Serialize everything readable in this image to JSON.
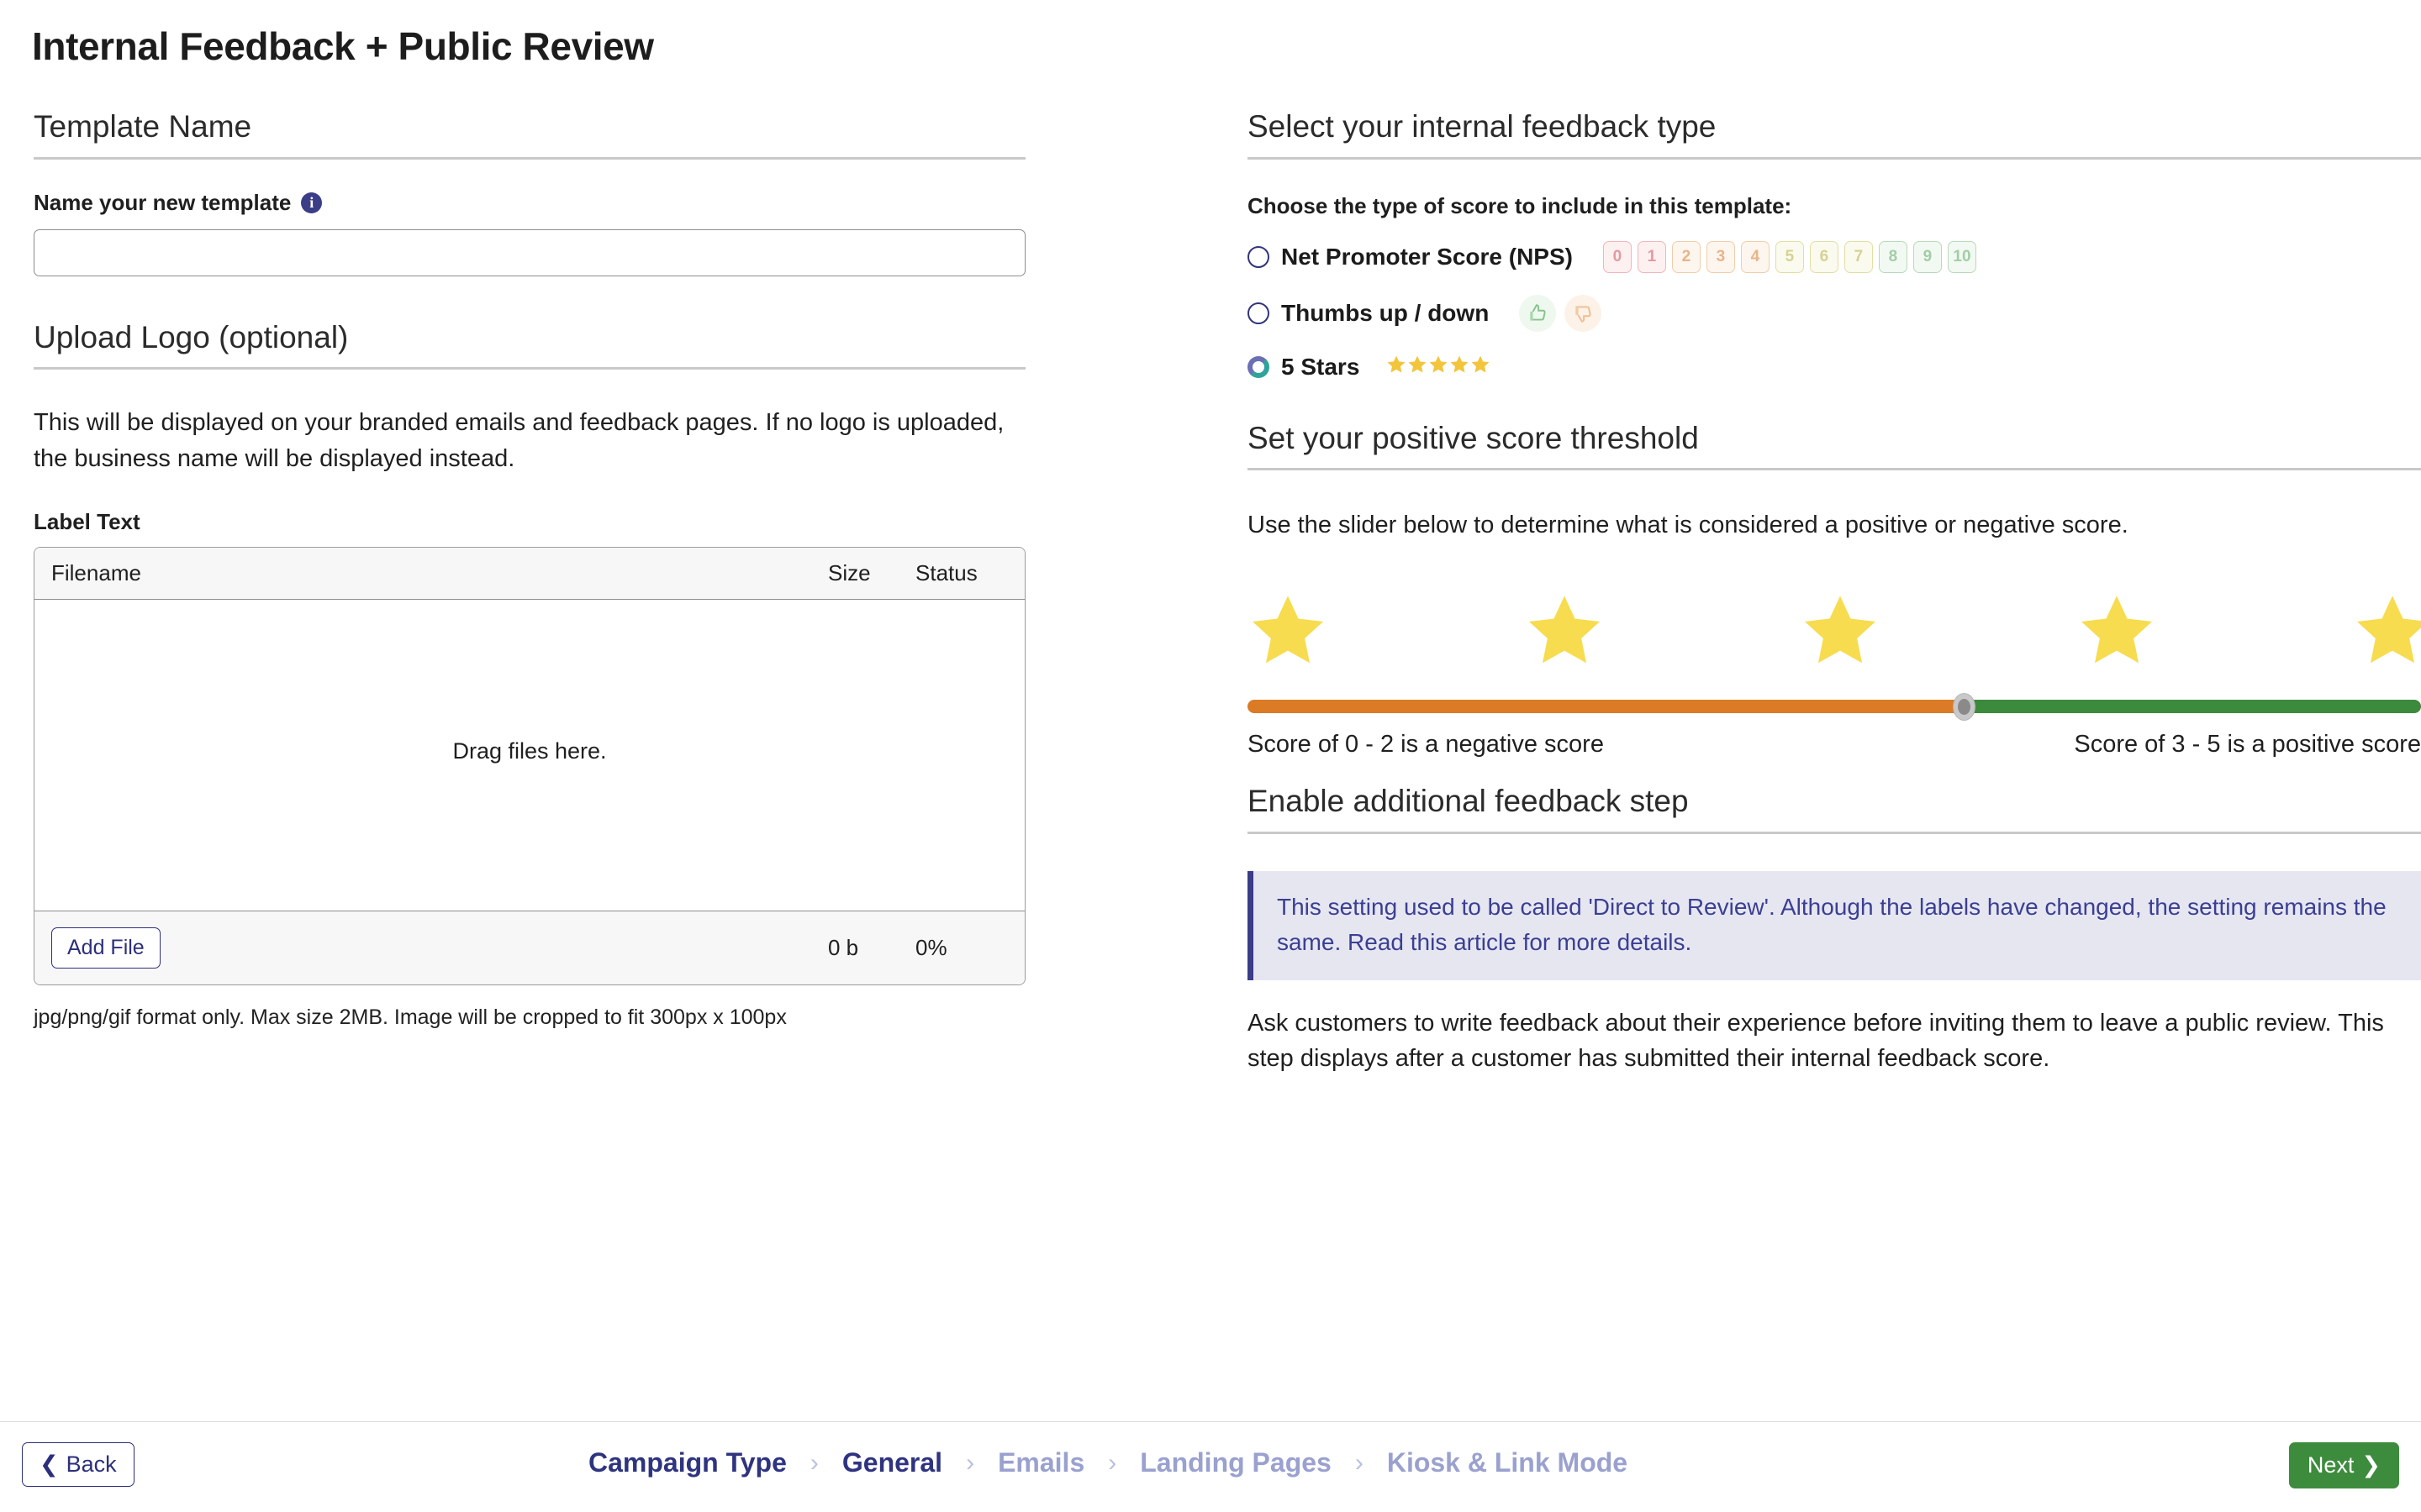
{
  "page": {
    "title": "Internal Feedback + Public Review"
  },
  "left": {
    "template_name": {
      "heading": "Template Name",
      "field_label": "Name your new template",
      "info_icon": "info-icon",
      "input_value": "",
      "input_placeholder": ""
    },
    "upload_logo": {
      "heading": "Upload Logo (optional)",
      "description": "This will be displayed on your branded emails and feedback pages. If no logo is uploaded, the business name will be displayed instead.",
      "label_text": "Label Text",
      "columns": {
        "filename": "Filename",
        "size": "Size",
        "status": "Status"
      },
      "drop_hint": "Drag files here.",
      "add_file_label": "Add File",
      "total_size": "0 b",
      "total_progress": "0%",
      "format_note": "jpg/png/gif format only. Max size 2MB. Image will be cropped to fit 300px x 100px"
    }
  },
  "right": {
    "feedback_type": {
      "heading": "Select your internal feedback type",
      "prompt": "Choose the type of score to include in this template:",
      "options": [
        {
          "label": "Net Promoter Score (NPS)",
          "selected": false,
          "preview": "nps"
        },
        {
          "label": "Thumbs up / down",
          "selected": false,
          "preview": "thumbs"
        },
        {
          "label": "5 Stars",
          "selected": true,
          "preview": "stars"
        }
      ],
      "nps_values": [
        "0",
        "1",
        "2",
        "3",
        "4",
        "5",
        "6",
        "7",
        "8",
        "9",
        "10"
      ],
      "thumbs_icons": [
        "thumbs-up-icon",
        "thumbs-down-icon"
      ],
      "star_count": 5
    },
    "threshold": {
      "heading": "Set your positive score threshold",
      "description": "Use the slider below to determine what is considered a positive or negative score.",
      "star_count": 5,
      "slider_percent": 61,
      "negative_label": "Score of 0 - 2 is a negative score",
      "positive_label": "Score of 3 - 5 is a positive score",
      "negative_color": "#db7b25",
      "positive_color": "#3c8a3c"
    },
    "additional_step": {
      "heading": "Enable additional feedback step",
      "callout": "This setting used to be called 'Direct to Review'. Although the labels have changed, the setting remains the same. Read this article for more details.",
      "description": "Ask customers to write feedback about their experience before inviting them to leave a public review. This step displays after a customer has submitted their internal feedback score."
    }
  },
  "footer": {
    "back_label": "Back",
    "next_label": "Next",
    "back_icon": "chevron-left-icon",
    "next_icon": "chevron-right-icon",
    "breadcrumbs": [
      {
        "label": "Campaign Type",
        "state": "active"
      },
      {
        "label": "General",
        "state": "active"
      },
      {
        "label": "Emails",
        "state": "inactive"
      },
      {
        "label": "Landing Pages",
        "state": "inactive"
      },
      {
        "label": "Kiosk & Link Mode",
        "state": "inactive"
      }
    ],
    "separator": "›"
  },
  "colors": {
    "brand_navy": "#2c2f7c",
    "next_green": "#3d8b3d",
    "star_gold": "#f2c53d",
    "star_bright": "#f7dc4f",
    "callout_bg": "#e6e6f1",
    "callout_text": "#3b3f93"
  }
}
